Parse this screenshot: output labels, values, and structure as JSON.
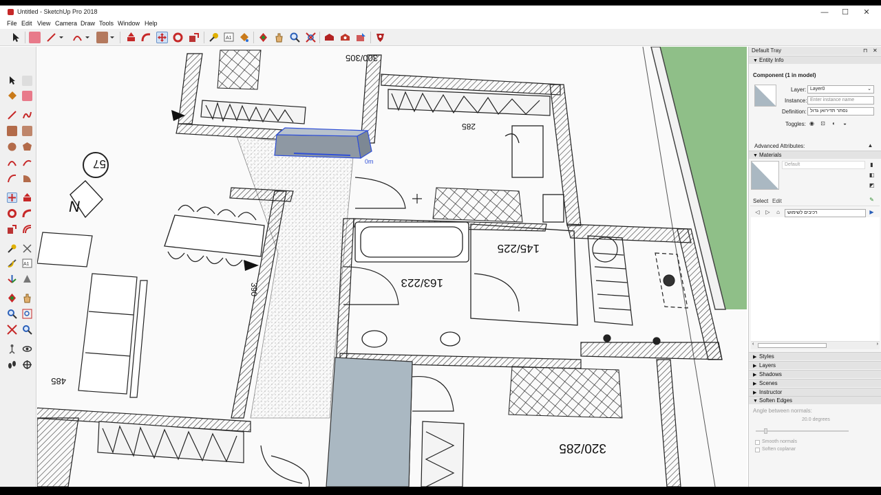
{
  "window": {
    "title": "Untitled - SketchUp Pro 2018",
    "controls": {
      "minimize": "—",
      "maximize": "☐",
      "close": "✕"
    }
  },
  "menu": [
    "File",
    "Edit",
    "View",
    "Camera",
    "Draw",
    "Tools",
    "Window",
    "Help"
  ],
  "viewport": {
    "room_labels": [
      "300/305",
      "285",
      "145/225",
      "163/223",
      "320/285",
      "390",
      "485"
    ],
    "north_label": "N",
    "circle_label": "57",
    "dimension_readout": "0m"
  },
  "tray": {
    "title": "Default Tray",
    "pin": "⊓",
    "close": "✕",
    "entity_info": {
      "header": "Entity Info",
      "component_title": "Component (1 in model)",
      "layer_label": "Layer:",
      "layer_value": "Layer0",
      "instance_label": "Instance:",
      "instance_placeholder": "Enter instance name",
      "definition_label": "Definition:",
      "definition_value": "נסתר תדירואן גדול",
      "toggles_label": "Toggles:",
      "advanced_label": "Advanced Attributes:"
    },
    "materials": {
      "header": "Materials",
      "material_name": "Default",
      "tabs": [
        "Select",
        "Edit"
      ],
      "collection": "רכיבים לשימוש"
    },
    "collapsed_panels": [
      "Styles",
      "Layers",
      "Shadows",
      "Scenes",
      "Instructor"
    ],
    "soften_edges": {
      "header": "Soften Edges",
      "angle_label": "Angle between normals:",
      "angle_value": "20.0  degrees",
      "smooth_normals": "Smooth normals",
      "soften_coplanar": "Soften coplanar"
    }
  },
  "colors": {
    "accent_blue": "#2f4fd8",
    "grass": "#8fbf88",
    "box_fill": "#aab8c2",
    "hatch": "#cfcfcf"
  }
}
